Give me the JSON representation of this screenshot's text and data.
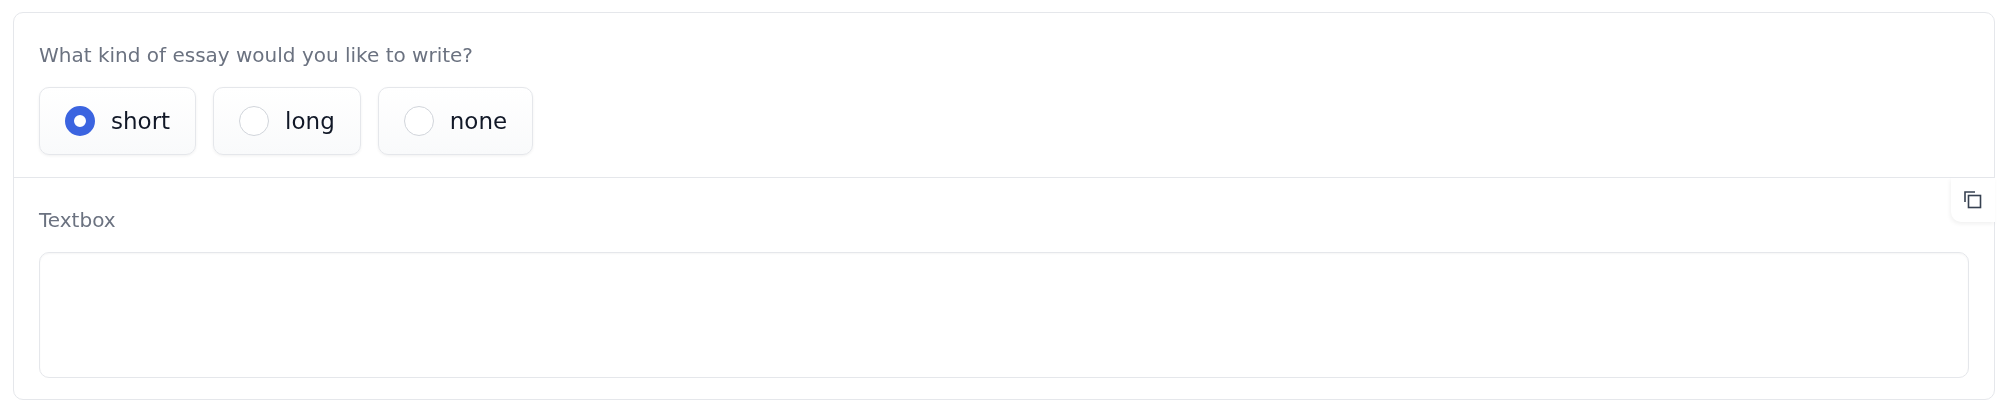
{
  "radio_group": {
    "label": "What kind of essay would you like to write?",
    "options": [
      {
        "label": "short",
        "selected": true
      },
      {
        "label": "long",
        "selected": false
      },
      {
        "label": "none",
        "selected": false
      }
    ]
  },
  "textbox": {
    "label": "Textbox"
  }
}
